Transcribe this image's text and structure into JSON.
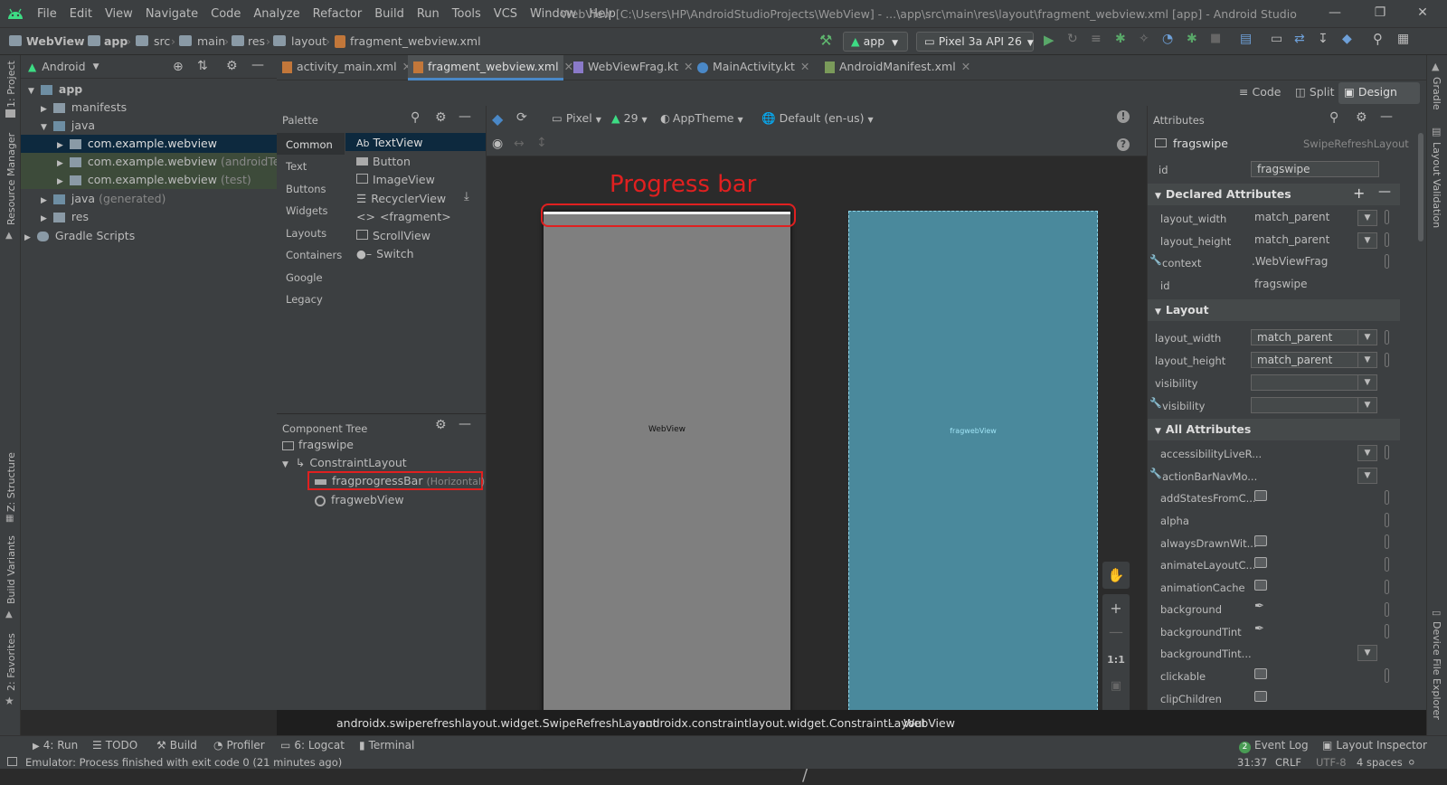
{
  "window": {
    "title": "WebView [C:\\Users\\HP\\AndroidStudioProjects\\WebView] - ...\\app\\src\\main\\res\\layout\\fragment_webview.xml [app] - Android Studio",
    "menu": [
      "File",
      "Edit",
      "View",
      "Navigate",
      "Code",
      "Analyze",
      "Refactor",
      "Build",
      "Run",
      "Tools",
      "VCS",
      "Window",
      "Help"
    ]
  },
  "breadcrumb": [
    "WebView",
    "app",
    "src",
    "main",
    "res",
    "layout",
    "fragment_webview.xml"
  ],
  "toolbar": {
    "run_config": "app",
    "device": "Pixel 3a API 26"
  },
  "left_stripe": [
    "1: Project",
    "Resource Manager",
    "Z: Structure",
    "Build Variants",
    "2: Favorites"
  ],
  "right_stripe": [
    "Gradle",
    "Layout Validation",
    "Device File Explorer"
  ],
  "project": {
    "view_mode": "Android",
    "tree": [
      {
        "label": "app",
        "suffix": ""
      },
      {
        "label": "manifests",
        "suffix": ""
      },
      {
        "label": "java",
        "suffix": ""
      },
      {
        "label": "com.example.webview",
        "suffix": ""
      },
      {
        "label": "com.example.webview",
        "suffix": "(androidTest)"
      },
      {
        "label": "com.example.webview",
        "suffix": "(test)"
      },
      {
        "label": "java",
        "suffix": "(generated)"
      },
      {
        "label": "res",
        "suffix": ""
      },
      {
        "label": "Gradle Scripts",
        "suffix": ""
      }
    ]
  },
  "editor_tabs": [
    "activity_main.xml",
    "fragment_webview.xml",
    "WebViewFrag.kt",
    "MainActivity.kt",
    "AndroidManifest.xml"
  ],
  "view_modes": [
    "Code",
    "Split",
    "Design"
  ],
  "palette": {
    "title": "Palette",
    "categories": [
      "Common",
      "Text",
      "Buttons",
      "Widgets",
      "Layouts",
      "Containers",
      "Google",
      "Legacy"
    ],
    "items": [
      "TextView",
      "Button",
      "ImageView",
      "RecyclerView",
      "<fragment>",
      "ScrollView",
      "Switch"
    ],
    "textview_prefix": "Ab"
  },
  "component_tree": {
    "title": "Component Tree",
    "nodes": [
      {
        "label": "fragswipe",
        "suffix": ""
      },
      {
        "label": "ConstraintLayout",
        "suffix": ""
      },
      {
        "label": "fragprogressBar",
        "suffix": "(Horizontal)"
      },
      {
        "label": "fragwebView",
        "suffix": ""
      }
    ]
  },
  "design": {
    "device": "Pixel",
    "api": "29",
    "theme": "AppTheme",
    "locale": "Default (en-us)",
    "annotation": "Progress bar",
    "webview_label": "WebView",
    "blueprint_label": "fragwebView",
    "zoom": "1:1"
  },
  "attributes": {
    "title": "Attributes",
    "component_id": "fragswipe",
    "component_class": "SwipeRefreshLayout",
    "id_label": "id",
    "id_value": "fragswipe",
    "declared_title": "Declared Attributes",
    "declared": [
      {
        "key": "layout_width",
        "value": "match_parent"
      },
      {
        "key": "layout_height",
        "value": "match_parent"
      },
      {
        "key": "context",
        "value": ".WebViewFrag"
      },
      {
        "key": "id",
        "value": "fragswipe"
      }
    ],
    "layout_title": "Layout",
    "layout": [
      {
        "key": "layout_width",
        "value": "match_parent"
      },
      {
        "key": "layout_height",
        "value": "match_parent"
      },
      {
        "key": "visibility",
        "value": ""
      },
      {
        "key": "visibility",
        "value": ""
      }
    ],
    "all_title": "All Attributes",
    "all": [
      "accessibilityLiveR...",
      "actionBarNavMo...",
      "addStatesFromC...",
      "alpha",
      "alwaysDrawnWit...",
      "animateLayoutC...",
      "animationCache",
      "background",
      "backgroundTint",
      "backgroundTint...",
      "clickable",
      "clipChildren"
    ]
  },
  "design_breadcrumb": [
    "androidx.swiperefreshlayout.widget.SwipeRefreshLayout",
    "androidx.constraintlayout.widget.ConstraintLayout",
    "WebView"
  ],
  "bottom_tools": [
    "4: Run",
    "TODO",
    "Build",
    "Profiler",
    "6: Logcat",
    "Terminal",
    "Event Log",
    "Layout Inspector"
  ],
  "event_log_count": "2",
  "status": {
    "message": "Emulator: Process finished with exit code 0 (21 minutes ago)",
    "position": "31:37",
    "line_sep": "CRLF",
    "encoding": "UTF-8",
    "indent": "4 spaces"
  },
  "colors": {
    "accent": "#4a88c7",
    "highlight": "#e02020",
    "android_green": "#3ddc84",
    "blueprint": "#4a899c"
  }
}
